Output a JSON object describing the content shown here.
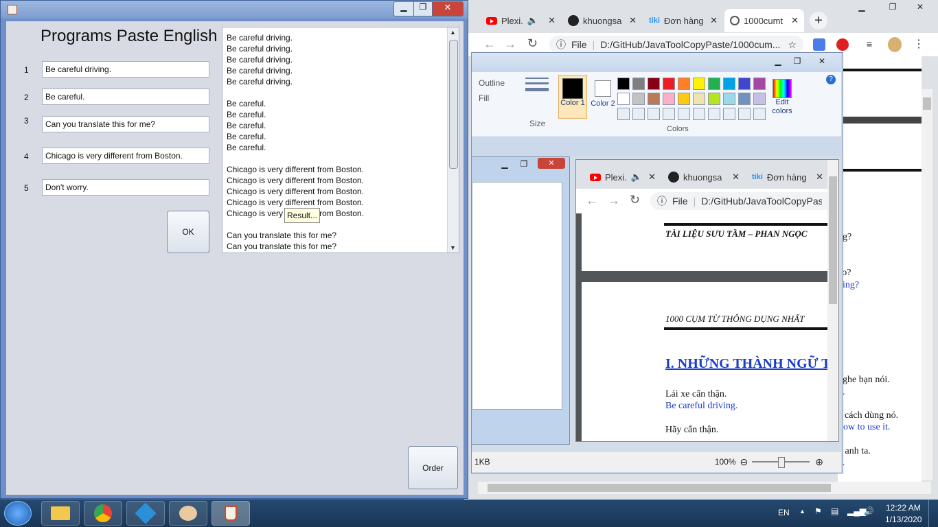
{
  "app": {
    "title": "Programs Paste English",
    "rows": [
      {
        "num": "1",
        "value": "Be careful driving."
      },
      {
        "num": "2",
        "value": "Be careful."
      },
      {
        "num": "3",
        "value": "Can you translate this for me?"
      },
      {
        "num": "4",
        "value": "Chicago is very different from Boston."
      },
      {
        "num": "5",
        "value": "Don't worry."
      }
    ],
    "ok_label": "OK",
    "order_label": "Order",
    "tooltip": "Result...",
    "result_text": "Be careful driving.\nBe careful driving.\nBe careful driving.\nBe careful driving.\nBe careful driving.\n\nBe careful.\nBe careful.\nBe careful.\nBe careful.\nBe careful.\n\nChicago is very different from Boston.\nChicago is very different from Boston.\nChicago is very different from Boston.\nChicago is very different from Boston.\nChicago is very different from Boston.\n\nCan you translate this for me?\nCan you translate this for me?"
  },
  "browser": {
    "tabs": [
      "Plexi.",
      "khuongsa",
      "Đơn hàng",
      "1000cumt"
    ],
    "file_label": "File",
    "url": "D:/GitHub/JavaToolCopyPaste/1000cum..."
  },
  "browser_bg_page": {
    "lines": [
      "ng?",
      "ào?",
      "ping?",
      "nghe bạn nói.",
      "u.",
      "cách dùng nó.",
      "ow to use it.",
      "h anh ta.",
      "n."
    ]
  },
  "paint": {
    "outline_label": "Outline",
    "fill_label": "Fill",
    "size_label": "Size",
    "color1_label": "Color 1",
    "color2_label": "Color 2",
    "edit_colors_label": "Edit colors",
    "colors_group_label": "Colors",
    "palette": [
      "#000000",
      "#7f7f7f",
      "#880015",
      "#ed1c24",
      "#ff7f27",
      "#fff200",
      "#22b14c",
      "#00a2e8",
      "#3f48cc",
      "#a349a4",
      "#ffffff",
      "#c3c3c3",
      "#b97a57",
      "#ffaec9",
      "#ffc90e",
      "#efe4b0",
      "#b5e61d",
      "#99d9ea",
      "#7092be",
      "#c8bfe7"
    ],
    "file_size": "1KB",
    "zoom": "100%"
  },
  "browser2": {
    "tabs": [
      "Plexi.",
      "khuongsa",
      "Đơn hàng"
    ],
    "file_label": "File",
    "url": "D:/GitHub/JavaToolCopyPaste",
    "doc_header": "TÀI LIỆU SƯU TẦM – PHAN NGỌC",
    "doc_subheader": "1000 CỤM TỪ THÔNG DỤNG NHẤT",
    "section_title": "I. NHỮNG THÀNH NGỮ T",
    "vi_1": "Lái xe cẩn thận.",
    "en_1": "Be careful driving.",
    "vi_2": "Hãy cẩn thận."
  },
  "taskbar": {
    "lang": "EN",
    "time": "12:22 AM",
    "date": "1/13/2020"
  }
}
